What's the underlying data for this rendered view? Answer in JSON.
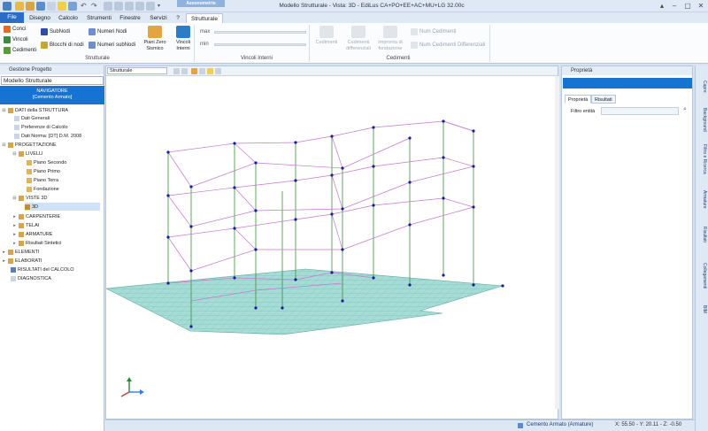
{
  "app_title": "Modello Strutturale - Vista: 3D - EdiLus CA+PO+EE+AC+MU+LG 32.00c",
  "context_tab": "Assonometria",
  "tabs": [
    "File",
    "Disegno",
    "Calcolo",
    "Strumenti",
    "Finestre",
    "Servizi",
    "?",
    "Strutturale"
  ],
  "ribbon": {
    "conci": "Conci",
    "vincoli": "Vincoli",
    "cedimenti": "Cedimenti",
    "subnodi": "SubNodi",
    "blocchi_nodi": "Blocchi di nodi",
    "numeri_nodi": "Numeri Nodi",
    "numeri_subnodi": "Numeri subNodi",
    "piani_zero": "Piani Zero Sismico",
    "vincoli_interni": "Vincoli Interni",
    "max": "max",
    "min": "min",
    "cedimenti2": "Cedimenti",
    "cedimenti_differenziali": "Cedimenti differenziali",
    "impronta_fondazione": "Impronta di fondazione",
    "num_cedimenti": "Num Cedimenti",
    "num_cedimenti_diff": "Num Cedimenti Differenziali",
    "group_strutturale": "Strutturale",
    "group_vincoli_interni": "Vincoli Interni",
    "group_cedimenti": "Cedimenti"
  },
  "left_panel": {
    "title": "Gestione Progetto",
    "model": "Modello Strutturale",
    "navigator_line1": "NAVIGATORE",
    "navigator_line2": "[Cemento Armato]",
    "tree": [
      "DATI della STRUTTURA",
      "Dati Generali",
      "Preferenze di Calcolo",
      "Dati Norma: [DT] D.M. 2008",
      "PROGETTAZIONE",
      "LIVELLI",
      "Piano Secondo",
      "Piano Primo",
      "Piano Terra",
      "Fondazione",
      "VISTE 3D",
      "3D",
      "CARPENTERIE",
      "TELAI",
      "ARMATURE",
      "Risultati Sintetici",
      "ELEMENTI",
      "ELABORATI",
      "RISULTATI del CALCOLO",
      "DIAGNOSTICA"
    ]
  },
  "viewport": {
    "view_select": "Strutturale"
  },
  "right_panel": {
    "title": "Proprietà",
    "tab_proprieta": "Proprietà",
    "tab_risultati": "Risultati",
    "filter_label": "Filtro entità"
  },
  "side_tabs": [
    "Capre",
    "Background",
    "Filtro e Ricerca",
    "Armature",
    "Risultati",
    "Collegamenti",
    "BIM"
  ],
  "status": {
    "material": "Cemento Armato (Armature)",
    "coords": "X: 55.50 - Y: 20.11 - Z: -0.50"
  },
  "colors": {
    "accent": "#1673d1",
    "slab": "#9ed8d2",
    "beam": "#c678d0",
    "column": "#3a8f3a",
    "node": "#1a1a9c"
  }
}
